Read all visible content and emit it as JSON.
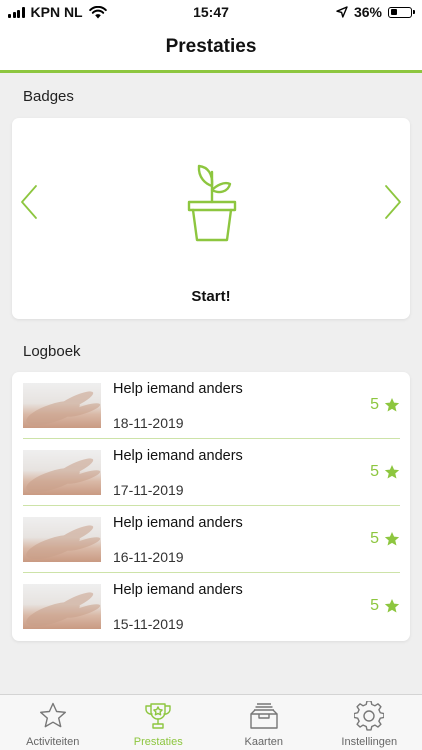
{
  "status_bar": {
    "carrier": "KPN NL",
    "time": "15:47",
    "battery": "36%",
    "battery_level": 0.36
  },
  "header": {
    "title": "Prestaties"
  },
  "badges": {
    "section_label": "Badges",
    "current_badge": {
      "title": "Start!",
      "icon": "plant-icon"
    }
  },
  "logbook": {
    "section_label": "Logboek",
    "entries": [
      {
        "title": "Help iemand anders",
        "date": "18-11-2019",
        "points": "5"
      },
      {
        "title": "Help iemand anders",
        "date": "17-11-2019",
        "points": "5"
      },
      {
        "title": "Help iemand anders",
        "date": "16-11-2019",
        "points": "5"
      },
      {
        "title": "Help iemand anders",
        "date": "15-11-2019",
        "points": "5"
      }
    ]
  },
  "tabs": [
    {
      "label": "Activiteiten",
      "icon": "star-icon",
      "active": false
    },
    {
      "label": "Prestaties",
      "icon": "trophy-icon",
      "active": true
    },
    {
      "label": "Kaarten",
      "icon": "card-tray-icon",
      "active": false
    },
    {
      "label": "Instellingen",
      "icon": "gear-icon",
      "active": false
    }
  ],
  "colors": {
    "accent": "#8dc63f",
    "background": "#efefef",
    "card": "#ffffff"
  }
}
